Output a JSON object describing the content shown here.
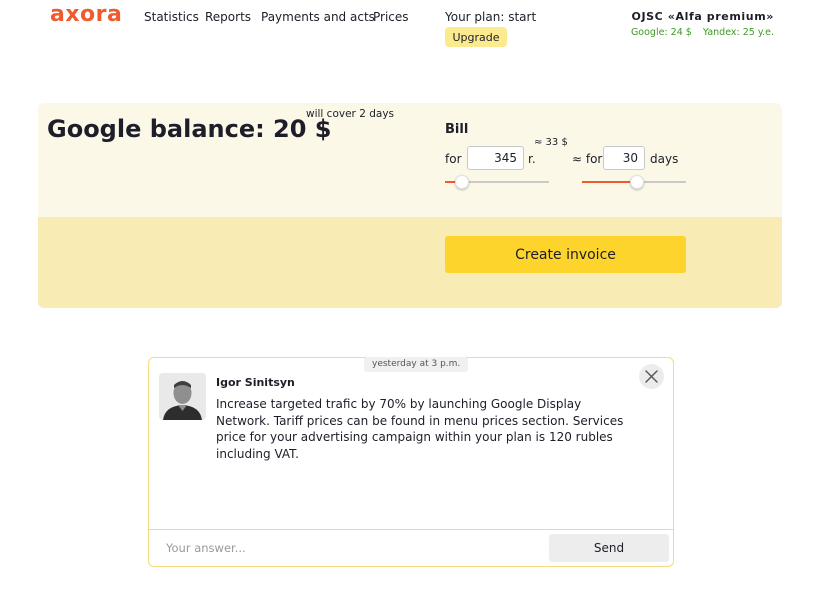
{
  "header": {
    "logo": "axora",
    "nav": [
      "Statistics",
      "Reports",
      "Payments and acts",
      "Prices"
    ],
    "plan_label": "Your plan: start",
    "upgrade_label": "Upgrade",
    "company": "OJSC «Alfa premium»",
    "balances": [
      "Google: 24 $",
      "Yandex: 25 y.e."
    ]
  },
  "balance": {
    "title": "Google balance: 20 $",
    "cover_note": "will cover 2 days",
    "bill_label": "Bill",
    "for_label": "for",
    "amount_value": "345",
    "currency": "r.",
    "approx_usd": "≈ 33 $",
    "for_days_label": "≈ for",
    "days_value": "30",
    "days_unit": "days",
    "amount_slider_level": 0.16,
    "days_slider_level": 0.53,
    "create_invoice_label": "Create invoice"
  },
  "message": {
    "time": "yesterday at 3 p.m.",
    "author": "Igor Sinitsyn",
    "text": "Increase targeted trafic by 70% by launching Google Display Network. Tariff prices can be found in menu prices section. Services price for your advertising campaign within your plan is 120 rubles including VAT.",
    "answer_placeholder": "Your answer...",
    "send_label": "Send"
  },
  "colors": {
    "brand": "#ef5a2e",
    "accent_yellow": "#fcd42b",
    "balance_green": "#3c9b22"
  },
  "icons": [
    "close-icon",
    "avatar-photo"
  ]
}
